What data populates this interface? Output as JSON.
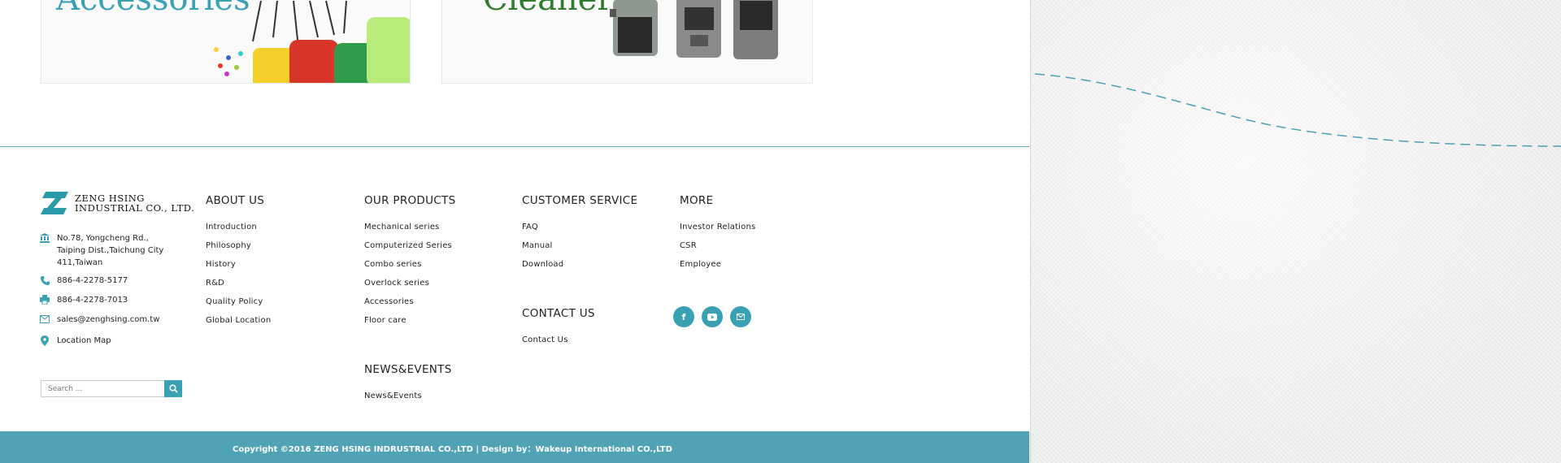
{
  "cards": [
    {
      "title": "Accessories"
    },
    {
      "title": "Cleaner"
    }
  ],
  "company": {
    "logo_line1": "ZENG HSING",
    "logo_line2": "INDUSTRIAL CO., LTD.",
    "address_line1": "No.78, Yongcheng Rd.,",
    "address_line2": "Taiping Dist.,Taichung City",
    "address_line3": "411,Taiwan",
    "phone": "886-4-2278-5177",
    "fax": "886-4-2278-7013",
    "email": "sales@zenghsing.com.tw",
    "map": "Location Map"
  },
  "search": {
    "placeholder": "Search ..."
  },
  "about": {
    "heading": "ABOUT US",
    "items": [
      "Introduction",
      "Philosophy",
      "History",
      "R&D",
      "Quality Policy",
      "Global Location"
    ]
  },
  "products": {
    "heading": "OUR PRODUCTS",
    "items": [
      "Mechanical series",
      "Computerized Series",
      "Combo series",
      "Overlock series",
      "Accessories",
      "Floor care"
    ]
  },
  "news": {
    "heading": "NEWS&EVENTS",
    "items": [
      "News&Events"
    ]
  },
  "service": {
    "heading": "CUSTOMER SERVICE",
    "items": [
      "FAQ",
      "Manual",
      "Download"
    ]
  },
  "contact": {
    "heading": "CONTACT US",
    "items": [
      "Contact Us"
    ]
  },
  "more": {
    "heading": "MORE",
    "items": [
      "Investor Relations",
      "CSR",
      "Employee"
    ]
  },
  "social": {
    "facebook": "f"
  },
  "footer": {
    "copyright": "Copyright ©2016 ZENG HSING INDRUSTRIAL CO.,LTD | Design by：Wakeup International CO.,LTD"
  },
  "colors": {
    "accent": "#3aa0b4",
    "footer_bar": "#4fa3b5",
    "divider": "#5ba6b7",
    "texture": "#f2f2f2"
  }
}
